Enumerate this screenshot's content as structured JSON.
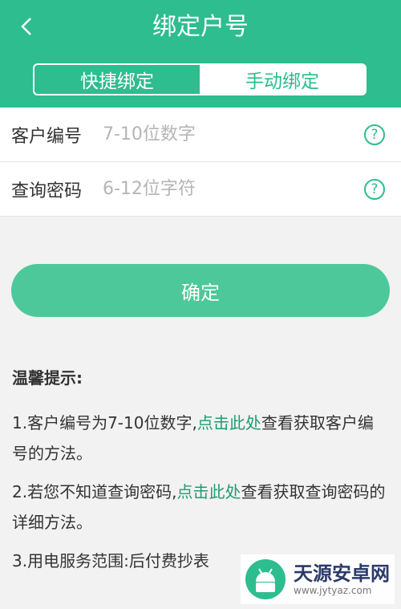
{
  "header": {
    "title": "绑定户号",
    "tabs": [
      {
        "label": "快捷绑定"
      },
      {
        "label": "手动绑定"
      }
    ]
  },
  "form": {
    "fields": [
      {
        "label": "客户编号",
        "placeholder": "7-10位数字",
        "help": "?"
      },
      {
        "label": "查询密码",
        "placeholder": "6-12位字符",
        "help": "?"
      }
    ],
    "confirm_label": "确定"
  },
  "tips": {
    "title": "温馨提示:",
    "items": [
      {
        "before": "1.客户编号为7-10位数字,",
        "link": "点击此处",
        "after": "查看获取客户编号的方法。"
      },
      {
        "before": "2.若您不知道查询密码,",
        "link": "点击此处",
        "after": "查看获取查询密码的详细方法。"
      },
      {
        "before": "3.用电服务范围:后付费抄表"
      }
    ]
  },
  "watermark": {
    "name": "天源安卓网",
    "url": "www.jytyaz.com"
  },
  "colors": {
    "primary": "#2dbd8f",
    "button": "#4dc89a",
    "link": "#1f9c73"
  }
}
